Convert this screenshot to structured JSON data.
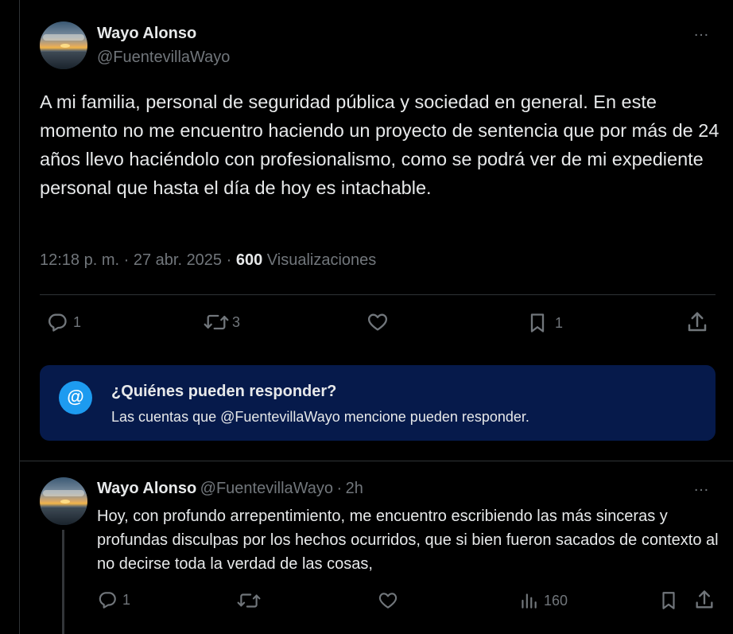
{
  "tweet": {
    "author_name": "Wayo Alonso",
    "author_handle": "@FuentevillaWayo",
    "more_icon": "…",
    "text": "A mi familia, personal de seguridad pública y sociedad en general. En este momento no me encuentro haciendo un proyecto de sentencia que por más de 24 años llevo haciéndolo con profesionalismo, como se podrá ver de mi expediente personal que hasta el día de hoy es intachable.",
    "time": "12:18 p. m.",
    "date": "27 abr. 2025",
    "views_count": "600",
    "views_label": "Visualizaciones",
    "actions": {
      "reply_icon": "reply-icon",
      "reply_count": "1",
      "retweet_icon": "retweet-icon",
      "retweet_count": "3",
      "like_icon": "heart-icon",
      "bookmark_icon": "bookmark-icon",
      "bookmark_count": "1",
      "share_icon": "share-icon"
    }
  },
  "reply_restriction": {
    "icon": "@",
    "title": "¿Quiénes pueden responder?",
    "description": "Las cuentas que @FuentevillaWayo mencione pueden responder.",
    "background_color": "#061a4b",
    "icon_color": "#1d9bf0"
  },
  "reply": {
    "author_name": "Wayo Alonso",
    "author_handle": "@FuentevillaWayo",
    "separator": "·",
    "time_ago": "2h",
    "more_icon": "…",
    "text": "Hoy, con profundo arrepentimiento, me encuentro escribiendo las más sinceras y profundas disculpas por los hechos ocurridos, que si bien fueron sacados de contexto al no decirse toda la verdad de las cosas,",
    "actions": {
      "reply_count": "1",
      "views_count": "160"
    }
  },
  "colors": {
    "background": "#000000",
    "text_primary": "#e7e9ea",
    "text_secondary": "#71767b",
    "border": "#2f3336"
  }
}
